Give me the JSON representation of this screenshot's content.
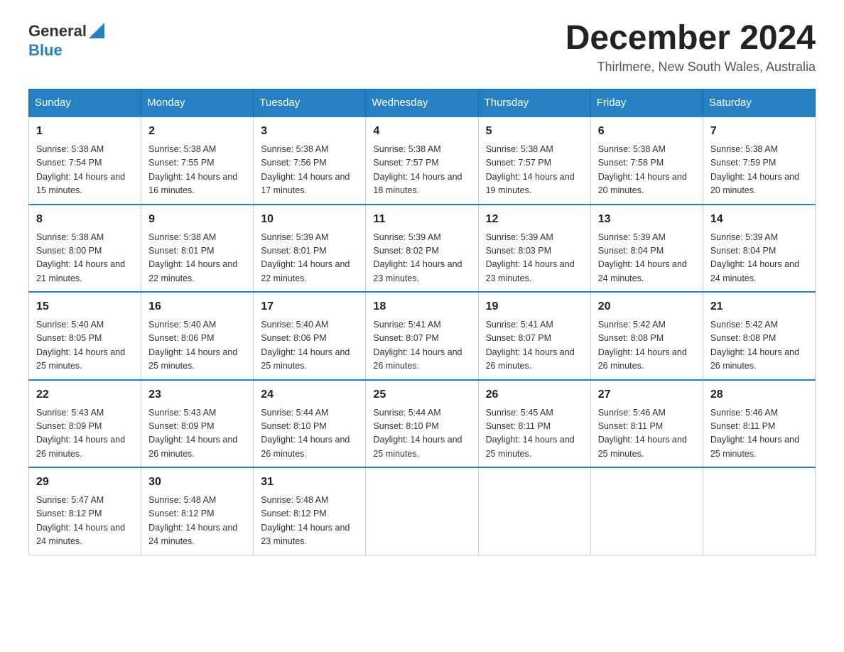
{
  "header": {
    "logo_text1": "General",
    "logo_text2": "Blue",
    "month_title": "December 2024",
    "subtitle": "Thirlmere, New South Wales, Australia"
  },
  "days_of_week": [
    "Sunday",
    "Monday",
    "Tuesday",
    "Wednesday",
    "Thursday",
    "Friday",
    "Saturday"
  ],
  "weeks": [
    [
      {
        "num": "1",
        "sunrise": "Sunrise: 5:38 AM",
        "sunset": "Sunset: 7:54 PM",
        "daylight": "Daylight: 14 hours and 15 minutes."
      },
      {
        "num": "2",
        "sunrise": "Sunrise: 5:38 AM",
        "sunset": "Sunset: 7:55 PM",
        "daylight": "Daylight: 14 hours and 16 minutes."
      },
      {
        "num": "3",
        "sunrise": "Sunrise: 5:38 AM",
        "sunset": "Sunset: 7:56 PM",
        "daylight": "Daylight: 14 hours and 17 minutes."
      },
      {
        "num": "4",
        "sunrise": "Sunrise: 5:38 AM",
        "sunset": "Sunset: 7:57 PM",
        "daylight": "Daylight: 14 hours and 18 minutes."
      },
      {
        "num": "5",
        "sunrise": "Sunrise: 5:38 AM",
        "sunset": "Sunset: 7:57 PM",
        "daylight": "Daylight: 14 hours and 19 minutes."
      },
      {
        "num": "6",
        "sunrise": "Sunrise: 5:38 AM",
        "sunset": "Sunset: 7:58 PM",
        "daylight": "Daylight: 14 hours and 20 minutes."
      },
      {
        "num": "7",
        "sunrise": "Sunrise: 5:38 AM",
        "sunset": "Sunset: 7:59 PM",
        "daylight": "Daylight: 14 hours and 20 minutes."
      }
    ],
    [
      {
        "num": "8",
        "sunrise": "Sunrise: 5:38 AM",
        "sunset": "Sunset: 8:00 PM",
        "daylight": "Daylight: 14 hours and 21 minutes."
      },
      {
        "num": "9",
        "sunrise": "Sunrise: 5:38 AM",
        "sunset": "Sunset: 8:01 PM",
        "daylight": "Daylight: 14 hours and 22 minutes."
      },
      {
        "num": "10",
        "sunrise": "Sunrise: 5:39 AM",
        "sunset": "Sunset: 8:01 PM",
        "daylight": "Daylight: 14 hours and 22 minutes."
      },
      {
        "num": "11",
        "sunrise": "Sunrise: 5:39 AM",
        "sunset": "Sunset: 8:02 PM",
        "daylight": "Daylight: 14 hours and 23 minutes."
      },
      {
        "num": "12",
        "sunrise": "Sunrise: 5:39 AM",
        "sunset": "Sunset: 8:03 PM",
        "daylight": "Daylight: 14 hours and 23 minutes."
      },
      {
        "num": "13",
        "sunrise": "Sunrise: 5:39 AM",
        "sunset": "Sunset: 8:04 PM",
        "daylight": "Daylight: 14 hours and 24 minutes."
      },
      {
        "num": "14",
        "sunrise": "Sunrise: 5:39 AM",
        "sunset": "Sunset: 8:04 PM",
        "daylight": "Daylight: 14 hours and 24 minutes."
      }
    ],
    [
      {
        "num": "15",
        "sunrise": "Sunrise: 5:40 AM",
        "sunset": "Sunset: 8:05 PM",
        "daylight": "Daylight: 14 hours and 25 minutes."
      },
      {
        "num": "16",
        "sunrise": "Sunrise: 5:40 AM",
        "sunset": "Sunset: 8:06 PM",
        "daylight": "Daylight: 14 hours and 25 minutes."
      },
      {
        "num": "17",
        "sunrise": "Sunrise: 5:40 AM",
        "sunset": "Sunset: 8:06 PM",
        "daylight": "Daylight: 14 hours and 25 minutes."
      },
      {
        "num": "18",
        "sunrise": "Sunrise: 5:41 AM",
        "sunset": "Sunset: 8:07 PM",
        "daylight": "Daylight: 14 hours and 26 minutes."
      },
      {
        "num": "19",
        "sunrise": "Sunrise: 5:41 AM",
        "sunset": "Sunset: 8:07 PM",
        "daylight": "Daylight: 14 hours and 26 minutes."
      },
      {
        "num": "20",
        "sunrise": "Sunrise: 5:42 AM",
        "sunset": "Sunset: 8:08 PM",
        "daylight": "Daylight: 14 hours and 26 minutes."
      },
      {
        "num": "21",
        "sunrise": "Sunrise: 5:42 AM",
        "sunset": "Sunset: 8:08 PM",
        "daylight": "Daylight: 14 hours and 26 minutes."
      }
    ],
    [
      {
        "num": "22",
        "sunrise": "Sunrise: 5:43 AM",
        "sunset": "Sunset: 8:09 PM",
        "daylight": "Daylight: 14 hours and 26 minutes."
      },
      {
        "num": "23",
        "sunrise": "Sunrise: 5:43 AM",
        "sunset": "Sunset: 8:09 PM",
        "daylight": "Daylight: 14 hours and 26 minutes."
      },
      {
        "num": "24",
        "sunrise": "Sunrise: 5:44 AM",
        "sunset": "Sunset: 8:10 PM",
        "daylight": "Daylight: 14 hours and 26 minutes."
      },
      {
        "num": "25",
        "sunrise": "Sunrise: 5:44 AM",
        "sunset": "Sunset: 8:10 PM",
        "daylight": "Daylight: 14 hours and 25 minutes."
      },
      {
        "num": "26",
        "sunrise": "Sunrise: 5:45 AM",
        "sunset": "Sunset: 8:11 PM",
        "daylight": "Daylight: 14 hours and 25 minutes."
      },
      {
        "num": "27",
        "sunrise": "Sunrise: 5:46 AM",
        "sunset": "Sunset: 8:11 PM",
        "daylight": "Daylight: 14 hours and 25 minutes."
      },
      {
        "num": "28",
        "sunrise": "Sunrise: 5:46 AM",
        "sunset": "Sunset: 8:11 PM",
        "daylight": "Daylight: 14 hours and 25 minutes."
      }
    ],
    [
      {
        "num": "29",
        "sunrise": "Sunrise: 5:47 AM",
        "sunset": "Sunset: 8:12 PM",
        "daylight": "Daylight: 14 hours and 24 minutes."
      },
      {
        "num": "30",
        "sunrise": "Sunrise: 5:48 AM",
        "sunset": "Sunset: 8:12 PM",
        "daylight": "Daylight: 14 hours and 24 minutes."
      },
      {
        "num": "31",
        "sunrise": "Sunrise: 5:48 AM",
        "sunset": "Sunset: 8:12 PM",
        "daylight": "Daylight: 14 hours and 23 minutes."
      },
      null,
      null,
      null,
      null
    ]
  ]
}
